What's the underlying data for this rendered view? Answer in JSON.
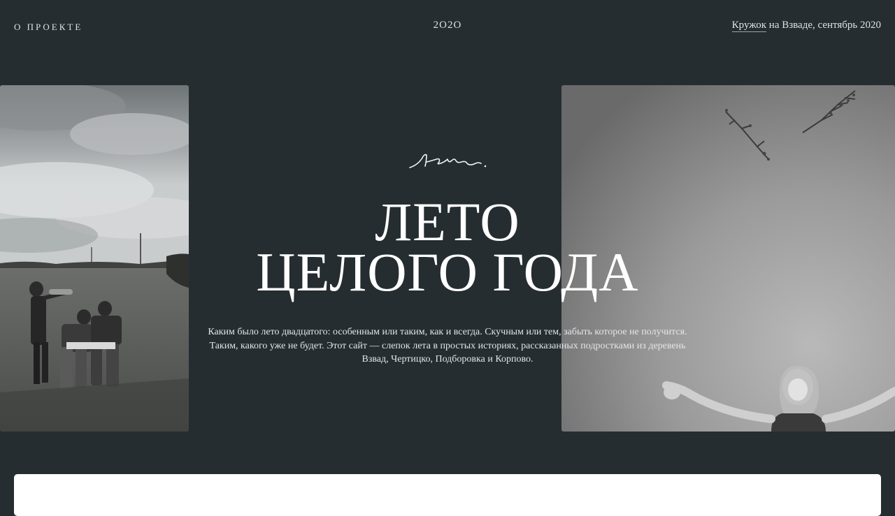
{
  "header": {
    "about_label": "О ПРОЕКТЕ",
    "year": "2O2O",
    "credit_link": "Кружок",
    "credit_rest": " на Взваде, сентябрь 2020"
  },
  "hero": {
    "script_word": "Лето.",
    "title_line1": "ЛЕТО",
    "title_line2": "ЦЕЛОГО ГОДА",
    "lede": "Каким было лето двадцатого: особенным или таким, как и всегда. Скучным или тем, забыть которое не получится. Таким, какого уже не будет. Этот сайт — слепок лета в простых историях, рассказанных подростками из деревень Взвад, Чертицко, Подборовка и Корпово."
  },
  "colors": {
    "background": "#252d31",
    "text": "#ffffff",
    "card": "#ffffff"
  }
}
